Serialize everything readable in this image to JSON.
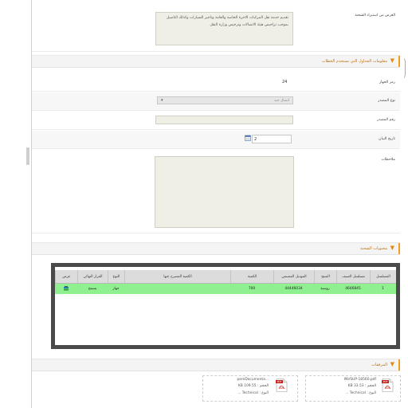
{
  "purpose": {
    "label": "الغرض من استيراد الشحنة",
    "text": "تقديم خدمة نقل المركبات الاجرة الخاصة والعامة وتاجير السيارات وكذلك التاصيل بموجب تراخيص هيئة الاتصالات وترخيص وزارة النقل"
  },
  "info_section": {
    "title": "معلومات الجداول التي تستخدم الخطاب"
  },
  "fields": {
    "device_count": {
      "label": "رمز الجهاز",
      "value": "24"
    },
    "source_type": {
      "label": "نوع المصدر",
      "value": "اتصال جيد"
    },
    "source_number": {
      "label": "رقم المصدر",
      "value": ""
    },
    "data_date": {
      "label": "تاريخ البيان",
      "value": "2"
    },
    "notes": {
      "label": "ملاحظات",
      "value": ""
    }
  },
  "contents_section": {
    "title": "محتويات الشحنة"
  },
  "table": {
    "headers": [
      "المسلسل",
      "مسلسل الصنف",
      "المنتج",
      "الموديل المصنعي",
      "الكمية",
      "الكمية المصرح عنها",
      "النوع",
      "القرار النهائي",
      "عرض"
    ],
    "rows": [
      [
        "1",
        "4646845",
        "روسية",
        "44446034",
        "700",
        "",
        "جهاز",
        "يسمح",
        "👁"
      ]
    ]
  },
  "attachments_section": {
    "title": "المرفقات"
  },
  "attachments": [
    {
      "name": "INVSUP-18560.pdf",
      "size": "الحجم : 33.53 KB",
      "type": "النوع : Technical ..."
    },
    {
      "name": "...pereDocumenta",
      "size": "الحجم : 109.55 KB",
      "type": "النوع : Technical ..."
    }
  ],
  "colors": {
    "accent": "#f0a020",
    "row_highlight": "#8ff08f",
    "table_frame": "#4a4a4a"
  },
  "icons": {
    "calendar": "calendar-icon",
    "pdf": "pdf-file-icon",
    "view": "view-icon",
    "collapse": "collapse-arrow-icon"
  }
}
